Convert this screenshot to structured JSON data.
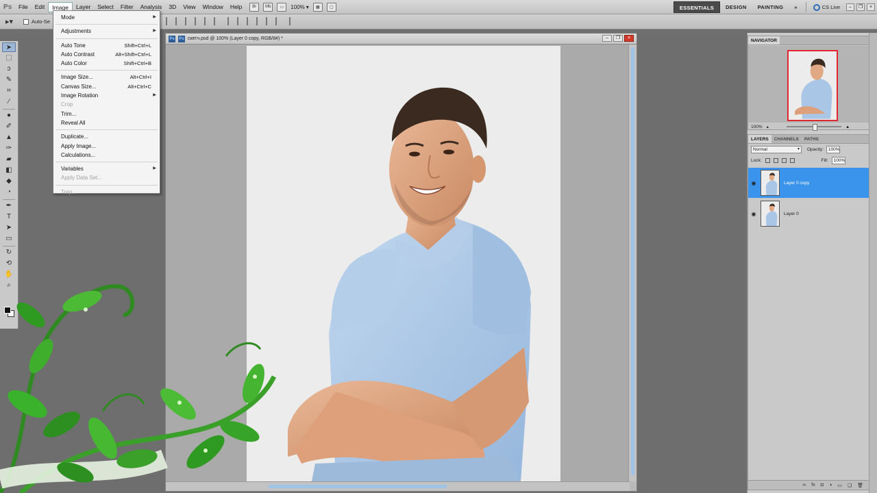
{
  "menubar": {
    "logo": "Ps",
    "items": [
      "File",
      "Edit",
      "Image",
      "Layer",
      "Select",
      "Filter",
      "Analysis",
      "3D",
      "View",
      "Window",
      "Help"
    ],
    "zoom": "100%",
    "icon_br": "Br",
    "icon_mb": "Mb"
  },
  "workspace": {
    "essentials": "ESSENTIALS",
    "design": "DESIGN",
    "painting": "PAINTING",
    "more": "»",
    "cslive": "CS Live"
  },
  "options": {
    "autoselect": "Auto-Se"
  },
  "document": {
    "tab_title": "скетч.psd @ 100% (Layer 0 copy, RGB/8#) *"
  },
  "image_menu": {
    "mode": "Mode",
    "adjustments": "Adjustments",
    "auto_tone": "Auto Tone",
    "auto_tone_sc": "Shift+Ctrl+L",
    "auto_contrast": "Auto Contrast",
    "auto_contrast_sc": "Alt+Shift+Ctrl+L",
    "auto_color": "Auto Color",
    "auto_color_sc": "Shift+Ctrl+B",
    "image_size": "Image Size...",
    "image_size_sc": "Alt+Ctrl+I",
    "canvas_size": "Canvas Size...",
    "canvas_size_sc": "Alt+Ctrl+C",
    "image_rotation": "Image Rotation",
    "crop": "Crop",
    "trim": "Trim...",
    "reveal_all": "Reveal All",
    "duplicate": "Duplicate...",
    "apply_image": "Apply Image...",
    "calculations": "Calculations...",
    "variables": "Variables",
    "apply_data_set": "Apply Data Set...",
    "trap": "Trap..."
  },
  "navigator": {
    "title": "NAVIGATOR",
    "zoom": "100%"
  },
  "layers_panel": {
    "tabs": [
      "LAYERS",
      "CHANNELS",
      "PATHS"
    ],
    "blend_mode": "Normal",
    "opacity_label": "Opacity:",
    "opacity": "100%",
    "lock_label": "Lock:",
    "fill_label": "Fill:",
    "fill": "100%",
    "layers": [
      {
        "name": "Layer 0 copy",
        "selected": true
      },
      {
        "name": "Layer 0",
        "selected": false
      }
    ]
  },
  "colors": {
    "selection": "#3b94ec",
    "canvas": "#ececec",
    "shirt": "#a9c6e6",
    "skin": "#e0a883",
    "leaf": "#3a9a2a"
  }
}
